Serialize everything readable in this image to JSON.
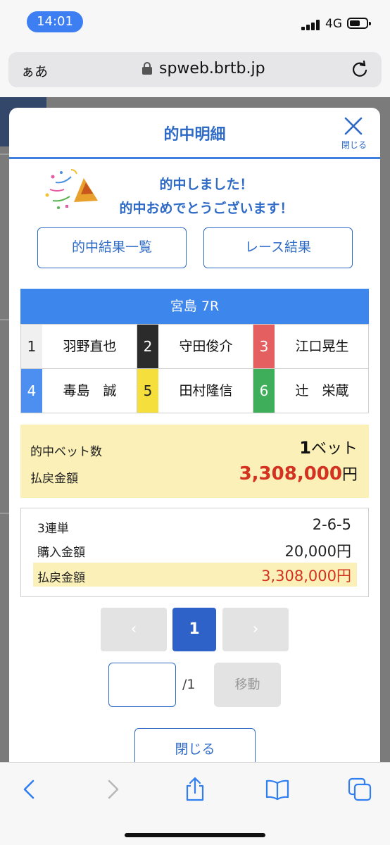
{
  "status_bar": {
    "time": "14:01",
    "network": "4G"
  },
  "browser": {
    "text_size_label": "ぁあ",
    "url": "spweb.brtb.jp"
  },
  "modal": {
    "title": "的中明細",
    "close_label": "閉じる",
    "message_line1": "的中しました！",
    "message_line2": "的中おめでとうございます！",
    "buttons": {
      "hit_results": "的中結果一覧",
      "race_results": "レース結果"
    },
    "race_title": "宮島 7R",
    "racers": [
      {
        "num": "1",
        "name": "羽野直也",
        "color": "#f0f0f0",
        "text_color": "#222222"
      },
      {
        "num": "2",
        "name": "守田俊介",
        "color": "#2b2b2b",
        "text_color": "#ffffff"
      },
      {
        "num": "3",
        "name": "江口晃生",
        "color": "#e45f5f",
        "text_color": "#ffffff"
      },
      {
        "num": "4",
        "name": "毒島　誠",
        "color": "#4c8ff0",
        "text_color": "#ffffff"
      },
      {
        "num": "5",
        "name": "田村隆信",
        "color": "#f5df3d",
        "text_color": "#222222"
      },
      {
        "num": "6",
        "name": "辻　栄蔵",
        "color": "#3fae5a",
        "text_color": "#ffffff"
      }
    ],
    "summary": {
      "bet_count_label": "的中ベット数",
      "bet_count_value": "1",
      "bet_count_unit": "ベット",
      "payout_label": "払戻金額",
      "payout_value": "3,308,000",
      "payout_unit": "円"
    },
    "detail": {
      "type": "3連単",
      "combination": "2-6-5",
      "purchase_label": "購入金額",
      "purchase_value": "20,000円",
      "payout_label": "払戻金額",
      "payout_value": "3,308,000円"
    },
    "pagination": {
      "prev": "‹",
      "current": "1",
      "next": "›",
      "total": "/1",
      "move_label": "移動"
    },
    "close_button": "閉じる"
  },
  "colors": {
    "accent_blue": "#2f6bc6",
    "race_header": "#3d86ec",
    "highlight": "#fbf0b7",
    "payout_red": "#d2321f"
  }
}
